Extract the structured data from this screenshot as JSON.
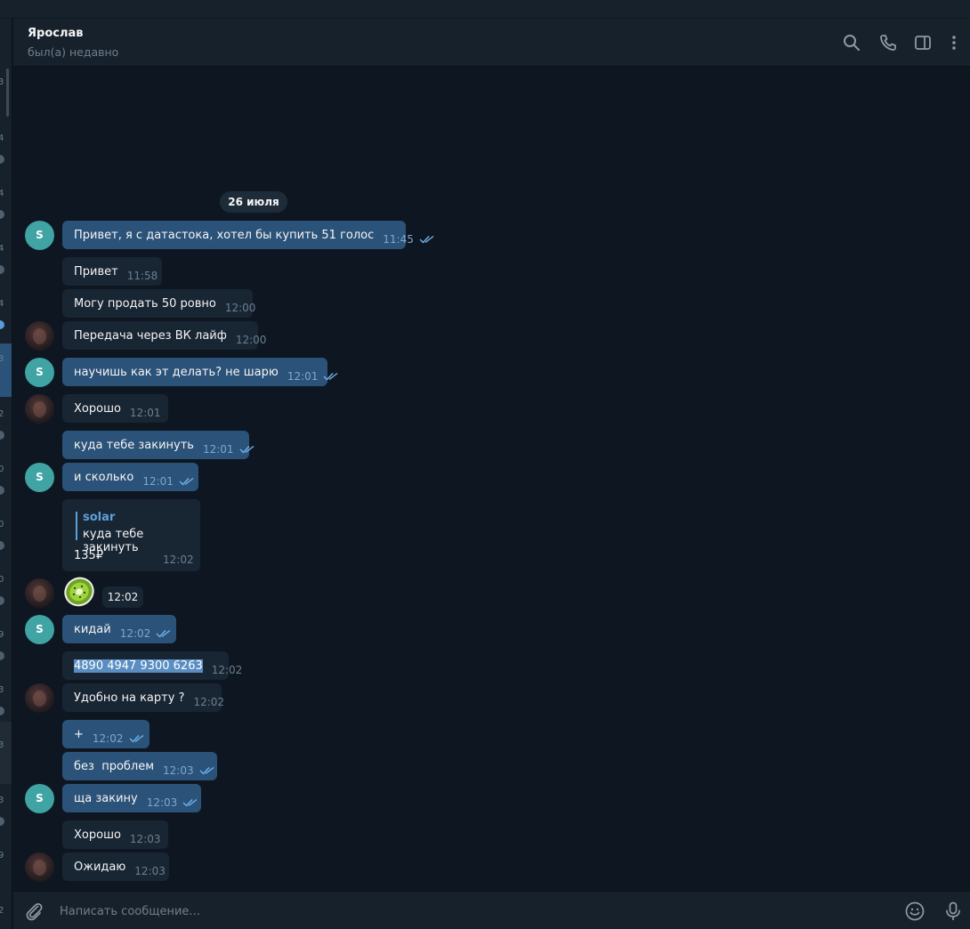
{
  "header": {
    "contact_name": "Ярослав",
    "contact_status": "был(а) недавно",
    "icons": [
      "search-icon",
      "phone-icon",
      "sidebar-toggle-icon",
      "more-vertical-icon"
    ]
  },
  "sidebar_fragments": [
    "3",
    "4",
    "4",
    "4",
    "4",
    "3",
    "2",
    "0",
    "0",
    "0",
    "9",
    "3",
    "3",
    "3",
    "9",
    "2"
  ],
  "chat": {
    "date_label": "26 июля",
    "messages": [
      {
        "text": "Привет, я с датастока, хотел бы купить 51 голос",
        "time": "11:45",
        "dir": "out"
      },
      {
        "text": "Привет",
        "time": "11:58",
        "dir": "in"
      },
      {
        "text": "Могу продать 50 ровно",
        "time": "12:00",
        "dir": "in"
      },
      {
        "text": "Передача через ВК лайф",
        "time": "12:00",
        "dir": "in"
      },
      {
        "text": "научишь как эт делать? не шарю",
        "time": "12:01",
        "dir": "out"
      },
      {
        "text": "Хорошо",
        "time": "12:01",
        "dir": "in"
      },
      {
        "text": "куда тебе закинуть",
        "time": "12:01",
        "dir": "out"
      },
      {
        "text": "и сколько",
        "time": "12:01",
        "dir": "out"
      },
      {
        "reply_to_name": "solar",
        "reply_to_text": "куда тебе закинуть",
        "text": "135₽",
        "time": "12:02",
        "dir": "in"
      },
      {
        "sticker": "kiwi-sticker",
        "time": "12:02",
        "dir": "in"
      },
      {
        "text": "кидай",
        "time": "12:02",
        "dir": "out"
      },
      {
        "text": "4890 4947 9300 6263",
        "time": "12:02",
        "dir": "in"
      },
      {
        "text": "Удобно на карту ?",
        "time": "12:02",
        "dir": "in"
      },
      {
        "text": "+",
        "time": "12:02",
        "dir": "out"
      },
      {
        "text": "без  проблем",
        "time": "12:03",
        "dir": "out"
      },
      {
        "text": "ща закину",
        "time": "12:03",
        "dir": "out"
      },
      {
        "text": "Хорошо",
        "time": "12:03",
        "dir": "in"
      },
      {
        "text": "Ожидаю",
        "time": "12:03",
        "dir": "in"
      }
    ],
    "avatar_letter": "S"
  },
  "composer": {
    "placeholder": "Написать сообщение...",
    "icons": [
      "attach-icon",
      "emoji-icon",
      "microphone-icon"
    ]
  },
  "colors": {
    "background": "#0e1621",
    "panel": "#17212b",
    "incoming_bubble": "#182533",
    "outgoing_bubble": "#2b5278",
    "accent": "#5ea0d8",
    "muted_text": "#6d7f8f",
    "avatar_teal": "#3fa4a3"
  }
}
